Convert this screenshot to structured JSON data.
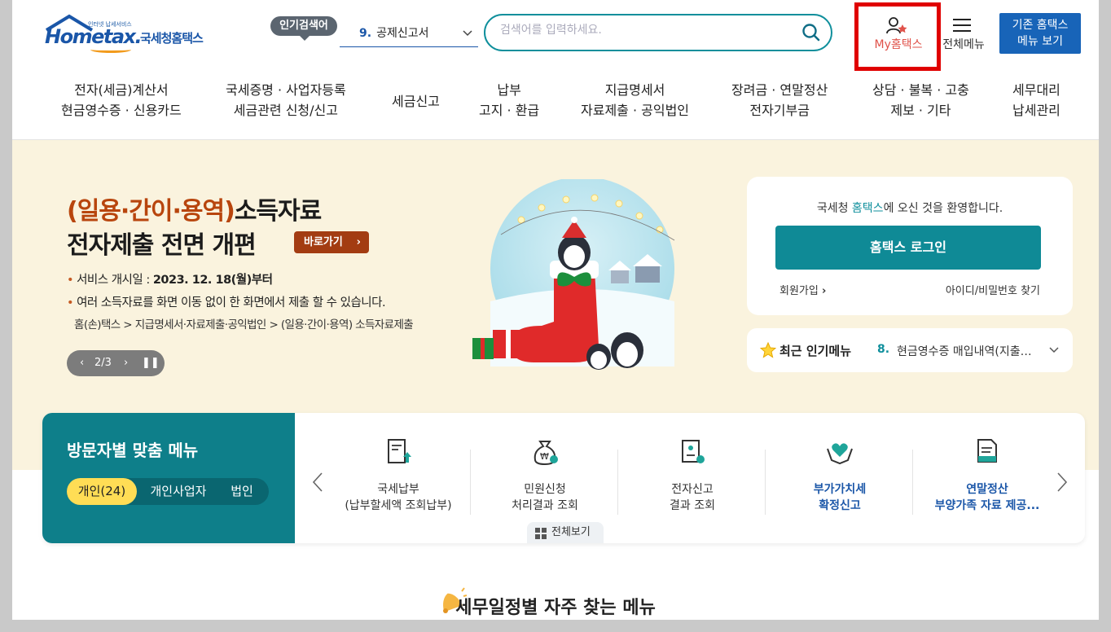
{
  "header": {
    "logo_small": "인터넷 납세서비스",
    "logo_word": "Hometax.",
    "logo_kr": "국세청홈택스",
    "popular_badge": "인기검색어",
    "popular_num": "9.",
    "popular_text": "공제신고서",
    "search_placeholder": "검색어를 입력하세요.",
    "myhome_label": "My홈택스",
    "menu_label": "전체메뉴",
    "old_menu_line1": "기존 홈택스",
    "old_menu_line2": "메뉴 보기"
  },
  "nav": [
    {
      "line1": "전자(세금)계산서",
      "line2": "현금영수증 · 신용카드"
    },
    {
      "line1": "국세증명 · 사업자등록",
      "line2": "세금관련 신청/신고"
    },
    {
      "line1": "세금신고",
      "line2": ""
    },
    {
      "line1": "납부",
      "line2": "고지 · 환급"
    },
    {
      "line1": "지급명세서",
      "line2": "자료제출 · 공익법인"
    },
    {
      "line1": "장려금 · 연말정산",
      "line2": "전자기부금"
    },
    {
      "line1": "상담 · 불복 · 고충",
      "line2": "제보 · 기타"
    },
    {
      "line1": "세무대리",
      "line2": "납세관리"
    }
  ],
  "hero": {
    "title_highlight": "(일용·간이·용역)",
    "title_rest": "소득자료",
    "title2": "전자제출 전면 개편",
    "go_button": "바로가기",
    "bullet1_label": "서비스 개시일 : ",
    "bullet1_value": "2023. 12. 18(월)부터",
    "bullet2": "여러 소득자료를 화면 이동 없이 한 화면에서 제출 할 수 있습니다.",
    "breadcrumb": "홈(손)택스 > 지급명세서·자료제출·공익법인 > (일용·간이·용역) 소득자료제출",
    "pager": "2/3"
  },
  "login": {
    "welcome_pre": "국세청 ",
    "welcome_hl": "홈택스",
    "welcome_post": "에 오신 것을 환영합니다.",
    "login_button": "홈택스 로그인",
    "join": "회원가입",
    "find": "아이디/비밀번호 찾기"
  },
  "recent": {
    "title": "최근 인기메뉴",
    "num": "8.",
    "text": "현금영수증 매입내역(지출증빙) 조회"
  },
  "visitor": {
    "title": "방문자별 맞춤 메뉴",
    "tabs": [
      "개인(24)",
      "개인사업자",
      "법인"
    ],
    "services": [
      {
        "line1": "국세납부",
        "line2": "(납부할세액 조회납부)",
        "icon": "tax-payment-icon"
      },
      {
        "line1": "민원신청",
        "line2": "처리결과 조회",
        "icon": "money-bag-icon"
      },
      {
        "line1": "전자신고",
        "line2": "결과 조회",
        "icon": "e-filing-icon"
      },
      {
        "line1": "부가가치세",
        "line2": "확정신고",
        "icon": "heart-hands-icon"
      },
      {
        "line1": "연말정산",
        "line2": "부양가족 자료 제공...",
        "icon": "document-icon"
      }
    ],
    "all_view": "전체보기"
  },
  "schedule_title": "세무일정별 자주 찾는 메뉴",
  "colors": {
    "teal": "#0f8a96",
    "blue": "#1a56a8",
    "hero_bg": "#faf3de",
    "highlight": "#e00000"
  }
}
